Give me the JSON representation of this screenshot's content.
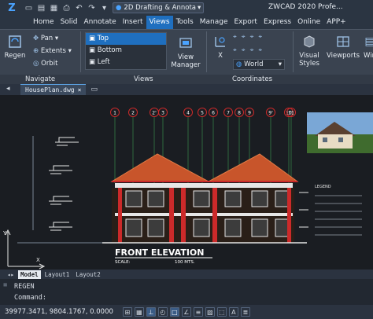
{
  "app": {
    "title": "ZWCAD 2020 Profe...",
    "workspace": "2D Drafting & Annota",
    "quick_access": [
      "new-icon",
      "open-icon",
      "save-icon",
      "print-icon",
      "undo-icon",
      "redo-icon",
      "dropdown-icon"
    ]
  },
  "menu": [
    "Home",
    "Solid",
    "Annotate",
    "Insert",
    "Views",
    "Tools",
    "Manage",
    "Export",
    "Express",
    "Online",
    "APP+"
  ],
  "ribbon": {
    "regen": "Regen",
    "pan": "Pan",
    "extents": "Extents",
    "orbit": "Orbit",
    "views_list": [
      "Top",
      "Bottom",
      "Left"
    ],
    "view_manager": [
      "View",
      "Manager"
    ],
    "coord_world": "World",
    "coord_x": "X",
    "visual_styles": [
      "Visual",
      "Styles"
    ],
    "viewports": "Viewports",
    "win": "Win",
    "groups": {
      "navigate": "Navigate",
      "views": "Views",
      "coordinates": "Coordinates"
    }
  },
  "doc_tab": "HousePlan.dwg",
  "drawing": {
    "grid_labels": [
      "1",
      "2",
      "2'",
      "3",
      "4",
      "5",
      "6",
      "7",
      "8",
      "9",
      "9'",
      "10",
      "11"
    ],
    "title": "FRONT ELEVATION",
    "scale_label": "SCALE:",
    "scale_value": "100 MTS.",
    "legend_title": "LEGEND",
    "ucs_x": "X",
    "ucs_y": "Y"
  },
  "layout_tabs": [
    "Model",
    "Layout1",
    "Layout2"
  ],
  "command": {
    "history": "REGEN",
    "prompt": "Command:"
  },
  "status": {
    "coords": "39977.3471, 9804.1767, 0.0000"
  },
  "colors": {
    "accent": "#1f6fbf",
    "roof": "#c8552b",
    "wall": "#e6e6e6",
    "red_line": "#cc2a2a"
  }
}
